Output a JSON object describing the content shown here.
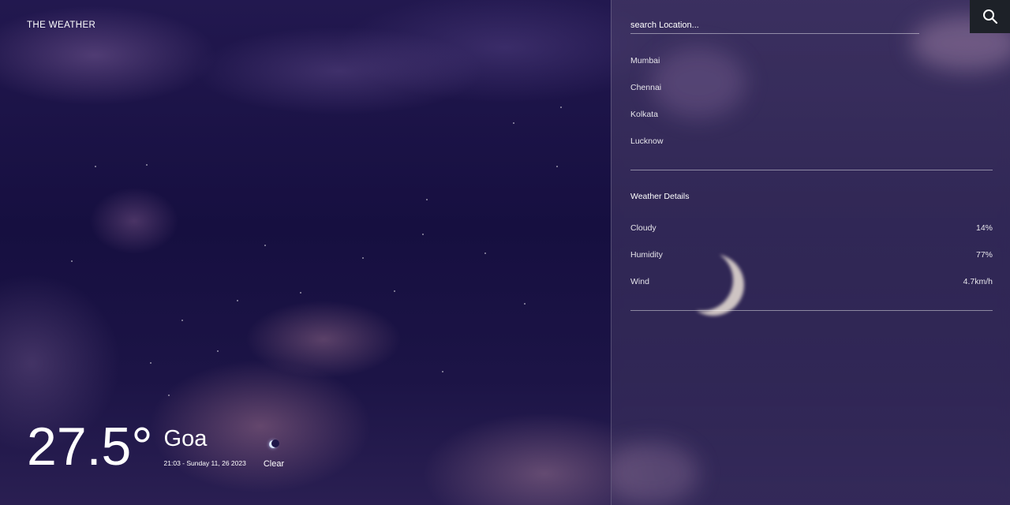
{
  "app": {
    "brand": "THE WEATHER"
  },
  "current": {
    "temperature": "27.5°",
    "city": "Goa",
    "datetime": "21:03 - Sunday 11, 26 2023",
    "condition": "Clear",
    "condition_icon": "crescent-moon-icon"
  },
  "search": {
    "placeholder": "search Location...",
    "button_icon": "search-icon"
  },
  "locations": [
    "Mumbai",
    "Chennai",
    "Kolkata",
    "Lucknow"
  ],
  "details": {
    "title": "Weather Details",
    "rows": [
      {
        "label": "Cloudy",
        "value": "14%"
      },
      {
        "label": "Humidity",
        "value": "77%"
      },
      {
        "label": "Wind",
        "value": "4.7km/h"
      }
    ]
  },
  "colors": {
    "background": "#1a1444",
    "panel": "#4a3f70",
    "search_button": "#1d2128",
    "text": "#ffffff"
  }
}
